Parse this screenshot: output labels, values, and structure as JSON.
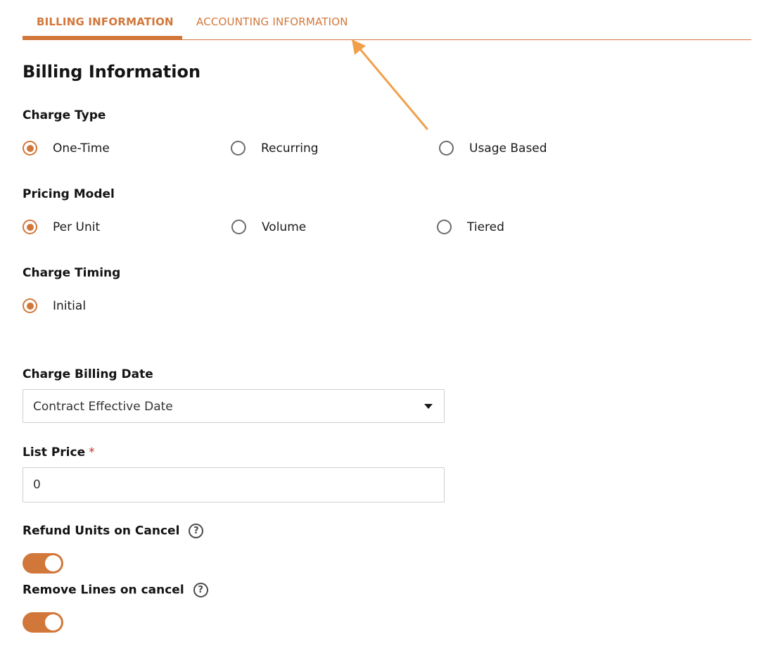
{
  "tabs": {
    "billing": "BILLING INFORMATION",
    "accounting": "ACCOUNTING INFORMATION"
  },
  "page_title": "Billing Information",
  "charge_type": {
    "label": "Charge Type",
    "options": [
      "One-Time",
      "Recurring",
      "Usage Based"
    ],
    "selected": "One-Time"
  },
  "pricing_model": {
    "label": "Pricing Model",
    "options": [
      "Per Unit",
      "Volume",
      "Tiered"
    ],
    "selected": "Per Unit"
  },
  "charge_timing": {
    "label": "Charge Timing",
    "options": [
      "Initial"
    ],
    "selected": "Initial"
  },
  "charge_billing_date": {
    "label": "Charge Billing Date",
    "value": "Contract Effective Date"
  },
  "list_price": {
    "label": "List Price",
    "required_marker": "*",
    "value": "0"
  },
  "refund_units": {
    "label": "Refund Units on Cancel",
    "help": "?",
    "enabled": true
  },
  "remove_lines": {
    "label": "Remove Lines on cancel",
    "help": "?",
    "enabled": true
  },
  "colors": {
    "accent": "#d2773a",
    "annotation_arrow": "#f0a04b",
    "required": "#c0392b"
  }
}
